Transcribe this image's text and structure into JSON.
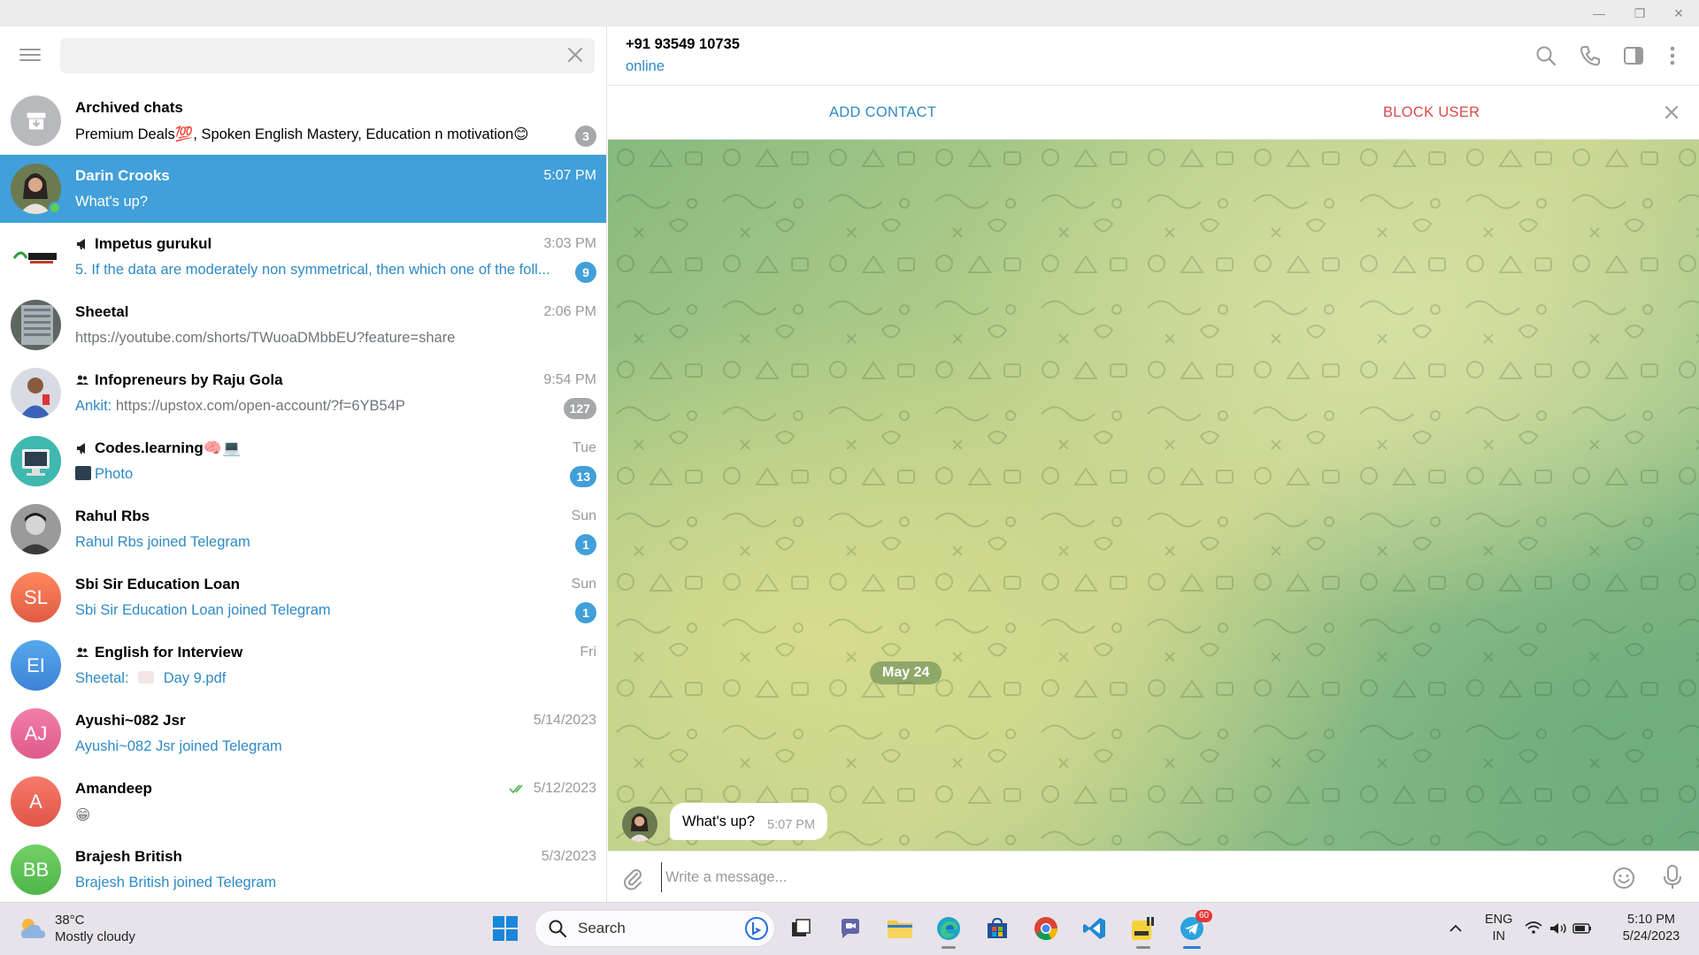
{
  "window": {
    "minimize": "—",
    "restore": "❐",
    "close": "✕"
  },
  "sidebar": {
    "search_placeholder": "",
    "search_value": "",
    "archived": {
      "title": "Archived chats",
      "preview": "Premium Deals💯, Spoken English Mastery, Education n motivation😊",
      "badge": "3"
    },
    "chats": [
      {
        "name": "Darin Crooks",
        "time": "5:07 PM",
        "preview": "What's up?",
        "active": true
      },
      {
        "name": "Impetus gurukul",
        "time": "3:03 PM",
        "preview": "5. If the data are moderately non symmetrical, then which one of the foll...",
        "badge": "9"
      },
      {
        "name": "Sheetal",
        "time": "2:06 PM",
        "preview": "https://youtube.com/shorts/TWuoaDMbbEU?feature=share"
      },
      {
        "name": "Infopreneurs by Raju Gola",
        "time": "9:54 PM",
        "preview_sender": "Ankit:",
        "preview": "https://upstox.com/open-account/?f=6YB54P",
        "badge": "127"
      },
      {
        "name": "Codes.learning🧠💻",
        "time": "Tue",
        "preview": "Photo",
        "badge": "13"
      },
      {
        "name": "Rahul Rbs",
        "time": "Sun",
        "preview": "Rahul Rbs joined Telegram",
        "badge": "1"
      },
      {
        "name": "Sbi Sir Education Loan",
        "initials": "SL",
        "time": "Sun",
        "preview": "Sbi Sir Education Loan joined Telegram",
        "badge": "1"
      },
      {
        "name": "English for Interview",
        "initials": "EI",
        "time": "Fri",
        "preview_sender": "Sheetal:",
        "preview": "Day 9.pdf"
      },
      {
        "name": "Ayushi~082 Jsr",
        "initials": "AJ",
        "time": "5/14/2023",
        "preview": "Ayushi~082 Jsr joined Telegram"
      },
      {
        "name": "Amandeep",
        "initials": "A",
        "time": "5/12/2023",
        "preview": "😁"
      },
      {
        "name": "Brajesh British",
        "initials": "BB",
        "time": "5/3/2023",
        "preview": "Brajesh British joined Telegram"
      }
    ]
  },
  "chat": {
    "peer_name": "+91 93549 10735",
    "peer_status": "online",
    "add_contact": "ADD CONTACT",
    "block_user": "BLOCK USER",
    "date_label": "May 24",
    "message": {
      "text": "What's up?",
      "time": "5:07 PM"
    },
    "input_placeholder": "Write a message..."
  },
  "taskbar": {
    "weather_temp": "38°C",
    "weather_desc": "Mostly cloudy",
    "search_label": "Search",
    "lang_top": "ENG",
    "lang_bottom": "IN",
    "clock_time": "5:10 PM",
    "clock_date": "5/24/2023",
    "telegram_badge": "60"
  },
  "colors": {
    "accent": "#419fd9",
    "link": "#2e8ac4",
    "danger": "#d94a4a",
    "online": "#5ccd55"
  }
}
